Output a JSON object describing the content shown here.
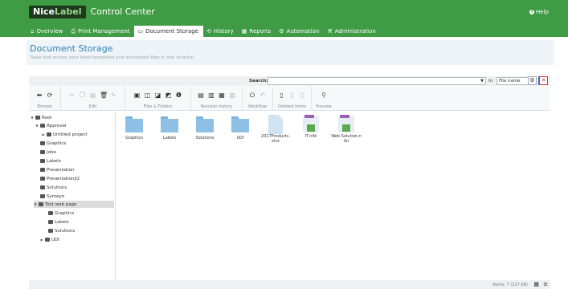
{
  "header": {
    "logo_a": "Nice",
    "logo_b": "Label",
    "product": "Control Center",
    "help": "Help"
  },
  "nav": [
    {
      "icon": "⌂",
      "label": "Overview",
      "active": false
    },
    {
      "icon": "⎙",
      "label": "Print Management",
      "active": false
    },
    {
      "icon": "▭",
      "label": "Document Storage",
      "active": true
    },
    {
      "icon": "⟲",
      "label": "History",
      "active": false
    },
    {
      "icon": "▦",
      "label": "Reports",
      "active": false
    },
    {
      "icon": "⚙",
      "label": "Automation",
      "active": false
    },
    {
      "icon": "⚒",
      "label": "Administration",
      "active": false
    }
  ],
  "page": {
    "title": "Document Storage",
    "subtitle": "Save and access your label templates and associated files in one location."
  },
  "search": {
    "label": "Search:",
    "value": "",
    "in_label": "in",
    "in_value": "File name"
  },
  "toolbar": {
    "groups": [
      {
        "label": "Browse"
      },
      {
        "label": "Edit"
      },
      {
        "label": "Files & Folders"
      },
      {
        "label": "Revision history"
      },
      {
        "label": "Workflow"
      },
      {
        "label": "Deleted items"
      },
      {
        "label": "Preview"
      }
    ]
  },
  "tree": [
    {
      "label": "Root"
    },
    {
      "label": "Approval"
    },
    {
      "label": "Untitled project"
    },
    {
      "label": "Graphics"
    },
    {
      "label": "Jobe"
    },
    {
      "label": "Labels"
    },
    {
      "label": "Presentation"
    },
    {
      "label": "Presentationjl2"
    },
    {
      "label": "Solutions"
    },
    {
      "label": "Symeyo"
    },
    {
      "label": "Test web page"
    },
    {
      "label": "Graphics"
    },
    {
      "label": "Labels"
    },
    {
      "label": "Solutions"
    },
    {
      "label": "UDI"
    }
  ],
  "files": [
    {
      "name": "Graphics"
    },
    {
      "name": "Labels"
    },
    {
      "name": "Solutions"
    },
    {
      "name": "UDI"
    },
    {
      "name": "2017Products.xlsx"
    },
    {
      "name": "IT.nlbl"
    },
    {
      "name": "Web Solution.nlbl"
    }
  ],
  "status": {
    "items": "Items: 7 (127 KB)"
  }
}
